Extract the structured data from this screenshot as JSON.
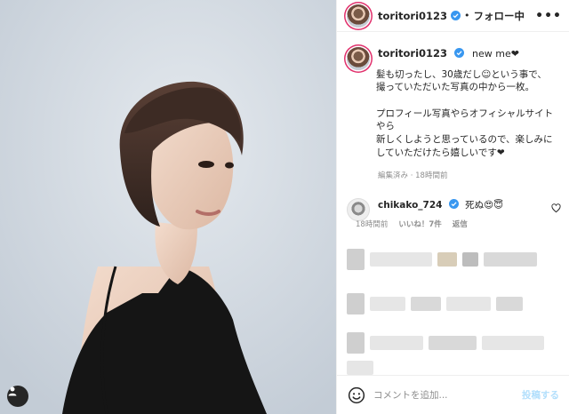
{
  "colors": {
    "accent": "#0095f6",
    "muted": "#8e8e8e",
    "post_disabled": "#b2dffc",
    "verified": "#3897f0"
  },
  "photo": {
    "alt": "",
    "tag_icon": "user-tag-icon"
  },
  "header": {
    "username": "toritori0123",
    "separator": "•",
    "follow_status": "フォロー中",
    "more": "•••"
  },
  "caption": {
    "username": "toritori0123",
    "title_text": "new me❤",
    "text": "髪も切ったし、30歳だし☺という事で、\n撮っていただいた写真の中から一枚。\n\nプロフィール写真やらオフィシャルサイトやら\n新しくしようと思っているので、楽しみにしていただけたら嬉しいです❤",
    "edited": "編集済み",
    "separator": "·",
    "time": "18時間前"
  },
  "comment": {
    "username": "chikako_724",
    "text": "死ぬ😍😇",
    "time": "18時間前",
    "likes": "いいね！7件",
    "reply": "返信"
  },
  "footer": {
    "placeholder": "コメントを追加...",
    "post_label": "投稿する",
    "emoji_icon": "smiley-icon"
  }
}
